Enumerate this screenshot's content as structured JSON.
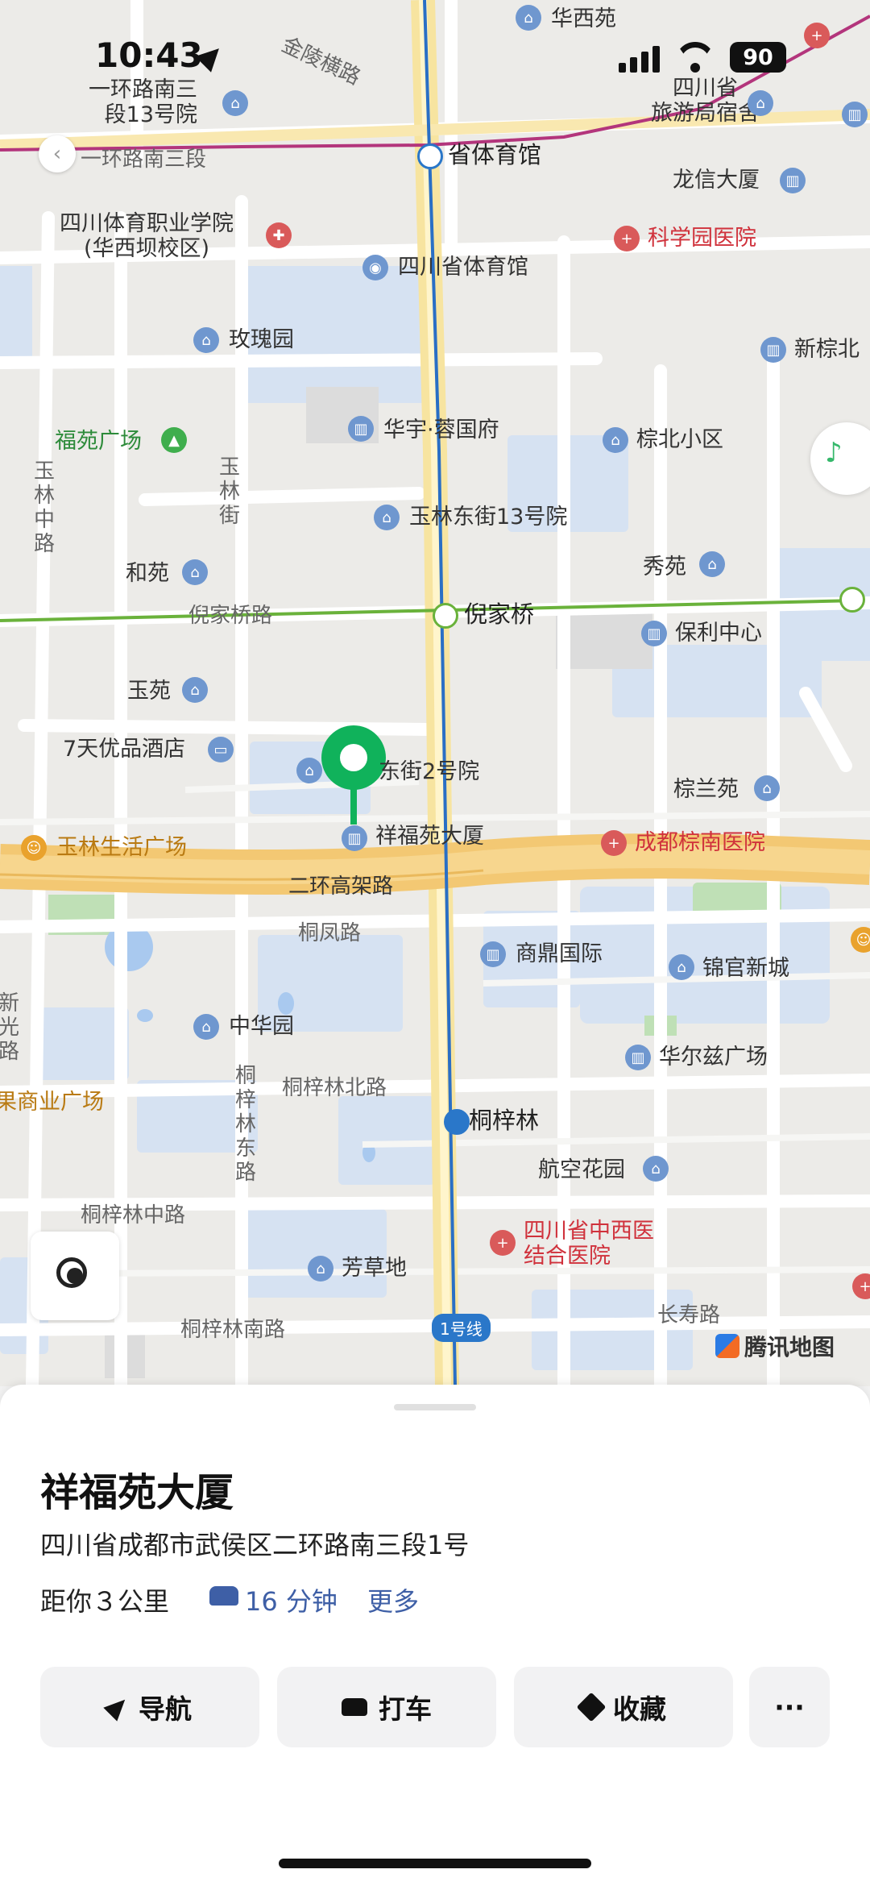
{
  "status_bar": {
    "time": "10:43",
    "battery": "90"
  },
  "map": {
    "labels": {
      "huaxiyuan": "华西苑",
      "jinling": "金陵横路",
      "yihuan13": "一环路南三\n段13号院",
      "yihuan3": "一环路南三段",
      "sichuan_tourism": "四川省\n旅游局宿舍",
      "shengtiyuguan": "省体育馆",
      "longxin": "龙信大厦",
      "tiyu_college": "四川体育职业学院\n(华西坝校区)",
      "kexueyuan_hosp": "科学园医院",
      "sichuan_tiyuguan": "四川省体育馆",
      "meiguiyuan": "玫瑰园",
      "xinzongbei": "新棕北",
      "fuyuan_square": "福苑广场",
      "huayu": "华宇·蓉国府",
      "zongbei": "棕北小区",
      "yulin_13": "玉林东街13号院",
      "heyuan": "和苑",
      "xiuyuan": "秀苑",
      "nijiaqiao_road": "倪家桥路",
      "nijiaqiao": "倪家桥",
      "baoli": "保利中心",
      "yuyuan": "玉苑",
      "hotel7": "7天优品酒店",
      "dongjie2": "东街2号院",
      "zonglanyuan": "棕兰苑",
      "yulin_life": "玉林生活广场",
      "xiangfuyuan": "祥福苑大厦",
      "zongnan_hosp": "成都棕南医院",
      "erhuan": "二环高架路",
      "tongfeng": "桐凤路",
      "shangding": "商鼎国际",
      "jinguan": "锦官新城",
      "zhonghuayuan": "中华园",
      "huaerzi": "华尔兹广场",
      "shangye": "果商业广场",
      "tongzilin_north": "桐梓林北路",
      "tongzilin": "桐梓林",
      "hangkong": "航空花园",
      "tongzilin_mid": "桐梓林中路",
      "sichuan_zxy": "四川省中西医\n结合医院",
      "fangcaodi": "芳草地",
      "changshou": "长寿路",
      "tongzilin_south": "桐梓林南路",
      "line1": "1号线",
      "tencent": "腾讯地图",
      "yulin_st_v": "玉林街",
      "yulin_zhong_v": "玉林中路",
      "tongzilin_east_v": "桐梓林东路",
      "xinguang_v": "新光路"
    }
  },
  "place": {
    "name": "祥福苑大厦",
    "address": "四川省成都市武侯区二环路南三段1号",
    "distance": "距你３公里",
    "drive_time": "16 分钟",
    "more": "更多"
  },
  "actions": {
    "navigate": "导航",
    "taxi": "打车",
    "favorite": "收藏",
    "more": "···"
  }
}
